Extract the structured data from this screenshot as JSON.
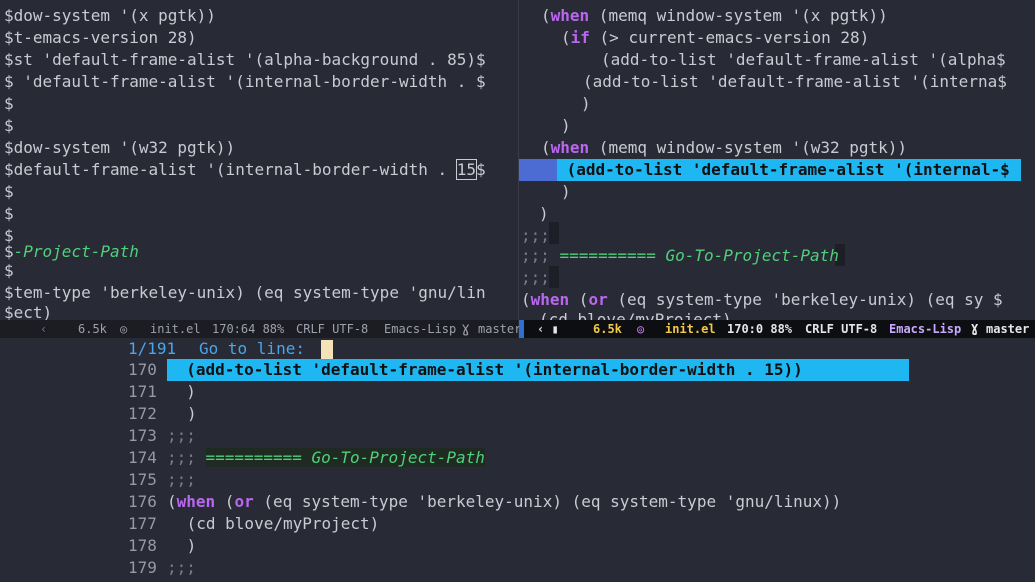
{
  "left_pane": {
    "lines": [
      "$dow-system '(x pgtk))",
      "$t-emacs-version 28)",
      "$st 'default-frame-alist '(alpha-background . 85)$",
      "$ 'default-frame-alist '(internal-border-width . $",
      "$",
      "$",
      "$dow-system '(w32 pgtk))",
      "$default-frame-alist '(internal-border-width . ",
      "$",
      "$",
      "$",
      "$",
      "$",
      "$tem-type 'berkeley-unix) (eq system-type 'gnu/lin",
      "$ect)"
    ],
    "cursor_char": "15",
    "cursor_after": "$",
    "section_name": "-Project-Path"
  },
  "right_pane": {
    "l1_kw": "when",
    "l1_rest": " (memq window-system '(x pgtk))",
    "l2_kw": "if",
    "l2_rest": " (> current-emacs-version 28)",
    "l3": "(add-to-list 'default-frame-alist '(alpha$",
    "l4": "(add-to-list 'default-frame-alist '(interna$",
    "l5": ")",
    "l6": ")",
    "l7_kw": "when",
    "l7_rest": " (memq window-system '(w32 pgtk))",
    "l8": " (add-to-list 'default-frame-alist '(internal-$",
    "l9": ")",
    "l10": ")",
    "l11": ";;;",
    "l12_cm": ";;; ",
    "l12_sec": "========== Go-To-Project-Path",
    "l13": ";;;",
    "l14_kw1": "when",
    "l14_kw2": "or",
    "l14_rest": " (eq system-type 'berkeley-unix) (eq sy $",
    "l15": "(cd blove/myProject)"
  },
  "modeline_left": {
    "size": "6.5k",
    "file": "init.el",
    "position": "170:64 88%",
    "encoding": "CRLF UTF-8",
    "mode": "Emacs-Lisp",
    "branch": "master"
  },
  "modeline_right": {
    "size": "6.5k",
    "file": "init.el",
    "position": "170:0 88%",
    "encoding": "CRLF UTF-8",
    "mode": "Emacs-Lisp",
    "branch": "master"
  },
  "goto_popup": {
    "counter": "1/191",
    "prompt": "Go to line:",
    "rows": [
      {
        "num": "170",
        "text": "  (add-to-list 'default-frame-alist '(internal-border-width . 15))"
      },
      {
        "num": "171",
        "text": "  )"
      },
      {
        "num": "172",
        "text": ")"
      },
      {
        "num": "173",
        "text": ";;;"
      },
      {
        "num": "174",
        "cm": ";;; ",
        "sec": "========== Go-To-Project-Path"
      },
      {
        "num": "175",
        "text": ";;;"
      },
      {
        "num": "176",
        "kw1": "when",
        "kw2": "or",
        "rest": " (eq system-type 'berkeley-unix) (eq system-type 'gnu/linux))"
      },
      {
        "num": "177",
        "text": " (cd blove/myProject)"
      },
      {
        "num": "178",
        "text": " )"
      },
      {
        "num": "179",
        "text": ";;;"
      }
    ]
  },
  "colors": {
    "background": "#282a36",
    "highlight": "#1fb7f2",
    "keyword": "#b967ef",
    "section": "#4fd07a",
    "modeline_active_text": "#f1c94a"
  }
}
